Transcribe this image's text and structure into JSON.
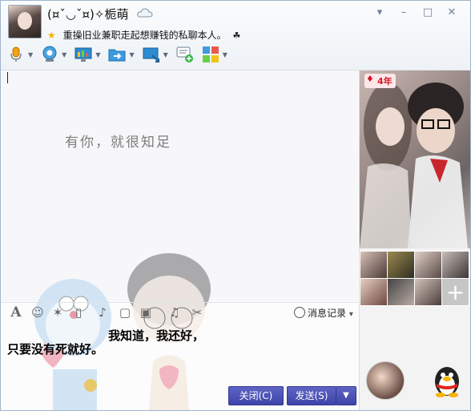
{
  "window": {
    "nickname": "(¤ˇ◡ˇ¤)✧栀萌",
    "signature": "重操旧业兼职走起想赚钱的私聊本人。",
    "signature_icon": "☘",
    "controls": [
      "▾",
      "–",
      "□",
      "✕"
    ]
  },
  "toolbar": {
    "items": [
      {
        "name": "voice-call",
        "icon": "microphone-icon"
      },
      {
        "name": "video-call",
        "icon": "webcam-icon"
      },
      {
        "name": "remote-desktop",
        "icon": "monitor-icon"
      },
      {
        "name": "send-file",
        "icon": "folder-transfer-icon"
      },
      {
        "name": "screen-share",
        "icon": "screen-share-icon"
      },
      {
        "name": "create-discussion",
        "icon": "chat-add-icon"
      },
      {
        "name": "apps",
        "icon": "apps-grid-icon"
      }
    ]
  },
  "chat": {
    "watermark_text": "有你，就很知足"
  },
  "side_panel": {
    "years_badge": "4年"
  },
  "input_toolbar": {
    "history_label": "消息记录",
    "history_caret": "▾"
  },
  "input": {
    "line1": "我知道，我还好，",
    "line2": "只要没有死就好。"
  },
  "buttons": {
    "close_label": "关闭(C)",
    "send_label": "发送(S)"
  },
  "colors": {
    "button": "#4a50b6",
    "badge": "#d0202a",
    "border": "#9fb5cc"
  }
}
